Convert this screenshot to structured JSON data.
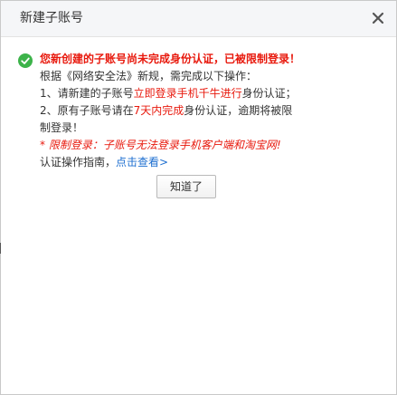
{
  "dialog": {
    "title": "新建子账号",
    "close_icon": "close-icon"
  },
  "message": {
    "status_icon": "check-circle-icon",
    "headline": "您新创建的子账号尚未完成身份认证，已被限制登录！",
    "intro": "根据《网络安全法》新规，需完成以下操作：",
    "step1_prefix": "1、请新建的子账号",
    "step1_highlight": "立即登录手机千牛进行",
    "step1_suffix": "身份认证；",
    "step2_prefix": "2、原有子账号请在",
    "step2_highlight": "7天内完成",
    "step2_suffix": "身份认证，逾期将被限制登录！",
    "note": "* 限制登录：子账号无法登录手机客户端和淘宝网!",
    "guide_label": "认证操作指南，",
    "guide_link": "点击查看>"
  },
  "buttons": {
    "ok_label": "知道了"
  },
  "colors": {
    "accent_red": "#e8190d",
    "link_blue": "#1e6fd0",
    "success_green": "#3cb34a"
  }
}
